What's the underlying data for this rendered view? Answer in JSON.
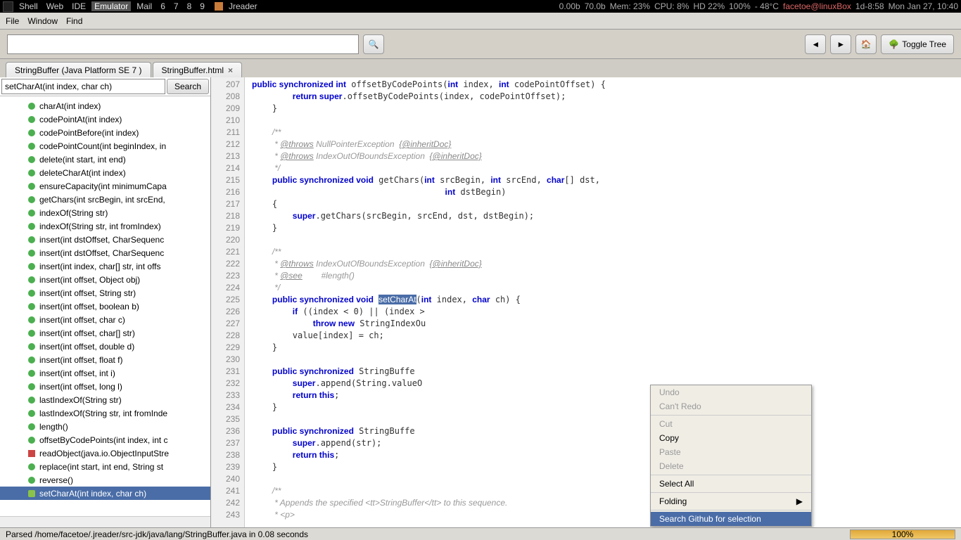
{
  "topbar": {
    "items": [
      "Shell",
      "Web",
      "IDE",
      "Emulator",
      "Mail",
      "6",
      "7",
      "8",
      "9"
    ],
    "app": "Jreader",
    "net": "0.00b",
    "netup": "70.0b",
    "mem": "Mem: 23%",
    "cpu": "CPU: 8%",
    "hd": "HD 22%",
    "bat": "100%",
    "temp": "- 48°C",
    "user": "facetoe@linuxBox",
    "uptime": "1d-8:58",
    "date": "Mon Jan 27, 10:40"
  },
  "menu": {
    "file": "File",
    "window": "Window",
    "find": "Find"
  },
  "toolbar": {
    "toggle": "Toggle Tree"
  },
  "tabs": [
    {
      "label": "StringBuffer (Java Platform SE 7 )"
    },
    {
      "label": "StringBuffer.html",
      "close": true
    }
  ],
  "sidebar": {
    "search_value": "setCharAt(int index, char ch)",
    "search_btn": "Search",
    "items": [
      {
        "t": "charAt(int index)"
      },
      {
        "t": "codePointAt(int index)"
      },
      {
        "t": "codePointBefore(int index)"
      },
      {
        "t": "codePointCount(int beginIndex, in"
      },
      {
        "t": "delete(int start, int end)"
      },
      {
        "t": "deleteCharAt(int index)"
      },
      {
        "t": "ensureCapacity(int minimumCapa"
      },
      {
        "t": "getChars(int srcBegin, int srcEnd,"
      },
      {
        "t": "indexOf(String str)"
      },
      {
        "t": "indexOf(String str, int fromIndex)"
      },
      {
        "t": "insert(int dstOffset, CharSequenc"
      },
      {
        "t": "insert(int dstOffset, CharSequenc"
      },
      {
        "t": "insert(int index, char[] str, int offs"
      },
      {
        "t": "insert(int offset, Object obj)"
      },
      {
        "t": "insert(int offset, String str)"
      },
      {
        "t": "insert(int offset, boolean b)"
      },
      {
        "t": "insert(int offset, char c)"
      },
      {
        "t": "insert(int offset, char[] str)"
      },
      {
        "t": "insert(int offset, double d)"
      },
      {
        "t": "insert(int offset, float f)"
      },
      {
        "t": "insert(int offset, int i)"
      },
      {
        "t": "insert(int offset, long l)"
      },
      {
        "t": "lastIndexOf(String str)"
      },
      {
        "t": "lastIndexOf(String str, int fromInde"
      },
      {
        "t": "length()"
      },
      {
        "t": "offsetByCodePoints(int index, int c"
      },
      {
        "t": "readObject(java.io.ObjectInputStre",
        "red": true
      },
      {
        "t": "replace(int start, int end, String st"
      },
      {
        "t": "reverse()"
      },
      {
        "t": "setCharAt(int index, char ch)",
        "sel": true
      }
    ]
  },
  "lines": [
    "207",
    "208",
    "209",
    "210",
    "211",
    "212",
    "213",
    "214",
    "215",
    "216",
    "217",
    "218",
    "219",
    "220",
    "221",
    "222",
    "223",
    "224",
    "225",
    "226",
    "227",
    "228",
    "229",
    "230",
    "231",
    "232",
    "233",
    "234",
    "235",
    "236",
    "237",
    "238",
    "239",
    "240",
    "241",
    "242",
    "243"
  ],
  "context": {
    "undo": "Undo",
    "redo": "Can't Redo",
    "cut": "Cut",
    "copy": "Copy",
    "paste": "Paste",
    "delete": "Delete",
    "selectall": "Select All",
    "folding": "Folding",
    "github": "Search Github for selection"
  },
  "status": {
    "text": "Parsed /home/facetoe/.jreader/src-jdk/java/lang/StringBuffer.java in 0.08 seconds",
    "pct": "100%"
  }
}
